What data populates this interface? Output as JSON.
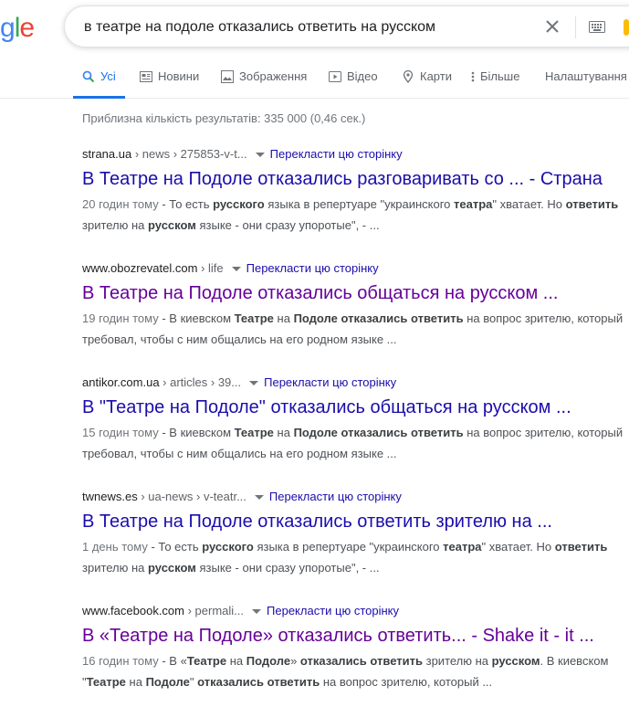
{
  "logo": {
    "part1": "g",
    "part2": "l",
    "part3": "e"
  },
  "search": {
    "query": "в театре на подоле отказались ответить на русском",
    "clear_icon": "close-icon",
    "keyboard_icon": "keyboard-icon"
  },
  "tabs": [
    {
      "label": "Усі",
      "icon": "search-icon"
    },
    {
      "label": "Новини",
      "icon": "news-icon"
    },
    {
      "label": "Зображення",
      "icon": "image-icon"
    },
    {
      "label": "Відео",
      "icon": "video-icon"
    },
    {
      "label": "Карти",
      "icon": "map-pin-icon"
    },
    {
      "label": "Більше",
      "icon": "more-vert-icon"
    },
    {
      "label": "Налаштування"
    }
  ],
  "stats": "Приблизна кількість результатів: 335 000 (0,46 сек.) ",
  "translate_label": "Перекласти цю сторінку",
  "results": [
    {
      "site": "strana.ua",
      "path": " › news › 275853-v-t...",
      "title": "В Театре на Подоле отказались разговаривать со ... - Страна",
      "snippet_parts": [
        {
          "t": "20 годин тому",
          "s": "date"
        },
        {
          "t": " - То есть "
        },
        {
          "t": "русского",
          "s": "b"
        },
        {
          "t": " языка в репертуаре \"украинского "
        },
        {
          "t": "театра",
          "s": "b"
        },
        {
          "t": "\" хватает. Но "
        },
        {
          "t": "ответить",
          "s": "b"
        },
        {
          "t": " зрителю на "
        },
        {
          "t": "русском",
          "s": "b"
        },
        {
          "t": " языке - они сразу упоротые\", - ..."
        }
      ]
    },
    {
      "site": "www.obozrevatel.com",
      "path": " › life",
      "title": "В Театре на Подоле отказались общаться на русском ...",
      "snippet_parts": [
        {
          "t": "19 годин тому",
          "s": "date"
        },
        {
          "t": " - В киевском "
        },
        {
          "t": "Театре",
          "s": "b"
        },
        {
          "t": " на "
        },
        {
          "t": "Подоле",
          "s": "b"
        },
        {
          "t": " "
        },
        {
          "t": "отказались",
          "s": "b"
        },
        {
          "t": " "
        },
        {
          "t": "ответить",
          "s": "b"
        },
        {
          "t": " на вопрос зрителю, который требовал, чтобы с ним общались на его родном языке ..."
        }
      ]
    },
    {
      "site": "antikor.com.ua",
      "path": " › articles › 39...",
      "title": "В \"Театре на Подоле\" отказались общаться на русском ...",
      "snippet_parts": [
        {
          "t": "15 годин тому",
          "s": "date"
        },
        {
          "t": " - В киевском "
        },
        {
          "t": "Театре",
          "s": "b"
        },
        {
          "t": " на "
        },
        {
          "t": "Подоле",
          "s": "b"
        },
        {
          "t": " "
        },
        {
          "t": "отказались",
          "s": "b"
        },
        {
          "t": " "
        },
        {
          "t": "ответить",
          "s": "b"
        },
        {
          "t": " на вопрос зрителю, который требовал, чтобы с ним общались на его родном языке ..."
        }
      ]
    },
    {
      "site": "twnews.es",
      "path": " › ua-news › v-teatr...",
      "title": "В Театре на Подоле отказались ответить зрителю на ...",
      "snippet_parts": [
        {
          "t": "1 день тому",
          "s": "date"
        },
        {
          "t": " - То есть "
        },
        {
          "t": "русского",
          "s": "b"
        },
        {
          "t": " языка в репертуаре \"украинского "
        },
        {
          "t": "театра",
          "s": "b"
        },
        {
          "t": "\" хватает. Но "
        },
        {
          "t": "ответить",
          "s": "b"
        },
        {
          "t": " зрителю на "
        },
        {
          "t": "русском",
          "s": "b"
        },
        {
          "t": " языке - они сразу упоротые\", - ..."
        }
      ]
    },
    {
      "site": "www.facebook.com",
      "path": " › permali...",
      "title": "В «Театре на Подоле» отказались ответить... - Shake it - it ...",
      "snippet_parts": [
        {
          "t": "16 годин тому",
          "s": "date"
        },
        {
          "t": " - В «"
        },
        {
          "t": "Театре",
          "s": "b"
        },
        {
          "t": " на "
        },
        {
          "t": "Подоле",
          "s": "b"
        },
        {
          "t": "» "
        },
        {
          "t": "отказались",
          "s": "b"
        },
        {
          "t": " "
        },
        {
          "t": "ответить",
          "s": "b"
        },
        {
          "t": " зрителю на "
        },
        {
          "t": "русском",
          "s": "b"
        },
        {
          "t": ". В киевском \""
        },
        {
          "t": "Театре",
          "s": "b"
        },
        {
          "t": " на "
        },
        {
          "t": "Подоле",
          "s": "b"
        },
        {
          "t": "\" "
        },
        {
          "t": "отказались",
          "s": "b"
        },
        {
          "t": " "
        },
        {
          "t": "ответить",
          "s": "b"
        },
        {
          "t": " на вопрос зрителю, который ..."
        }
      ]
    }
  ],
  "colors": {
    "link": "#1a0dab",
    "visited": "#660099",
    "accent": "#1a73e8"
  }
}
